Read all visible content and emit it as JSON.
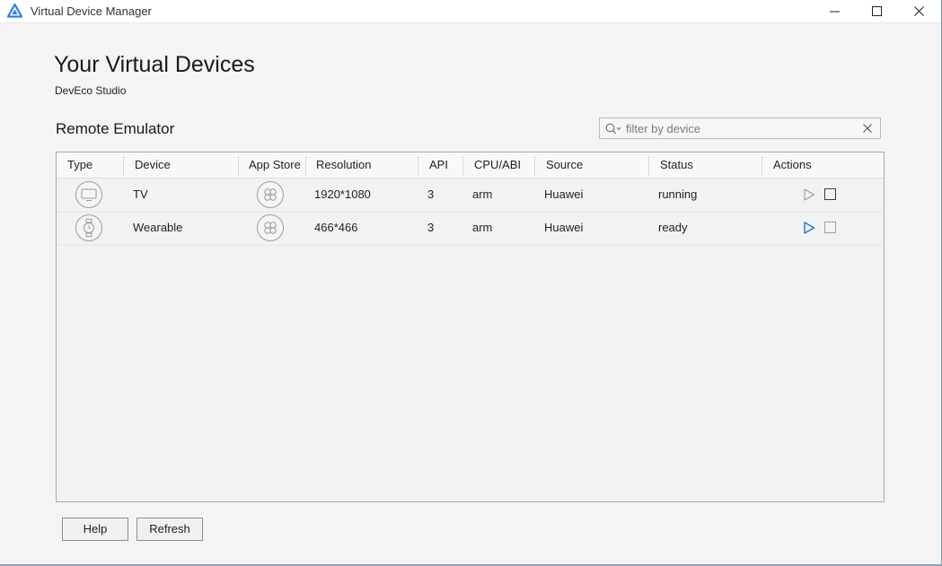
{
  "window": {
    "title": "Virtual Device Manager",
    "controls": {
      "minimize": "minimize-icon",
      "maximize": "maximize-icon",
      "close": "close-icon"
    }
  },
  "page": {
    "title": "Your Virtual Devices",
    "subtitle": "DevEco Studio",
    "section_title": "Remote Emulator"
  },
  "filter": {
    "placeholder": "filter by device",
    "value": ""
  },
  "table": {
    "columns": [
      "Type",
      "Device",
      "App Store",
      "Resolution",
      "API",
      "CPU/ABI",
      "Source",
      "Status",
      "Actions"
    ],
    "rows": [
      {
        "type_icon": "tv-icon",
        "device": "TV",
        "app_store_icon": "app-store-icon",
        "resolution": "1920*1080",
        "api": "3",
        "cpu_abi": "arm",
        "source": "Huawei",
        "status": "running",
        "play_enabled": false,
        "stop_enabled": true
      },
      {
        "type_icon": "watch-icon",
        "device": "Wearable",
        "app_store_icon": "app-store-icon",
        "resolution": "466*466",
        "api": "3",
        "cpu_abi": "arm",
        "source": "Huawei",
        "status": "ready",
        "play_enabled": true,
        "stop_enabled": false
      }
    ]
  },
  "buttons": {
    "help": "Help",
    "refresh": "Refresh"
  },
  "colors": {
    "accent": "#1a73e8",
    "logo": "#2b7de9",
    "disabled": "#9a9a9a"
  }
}
